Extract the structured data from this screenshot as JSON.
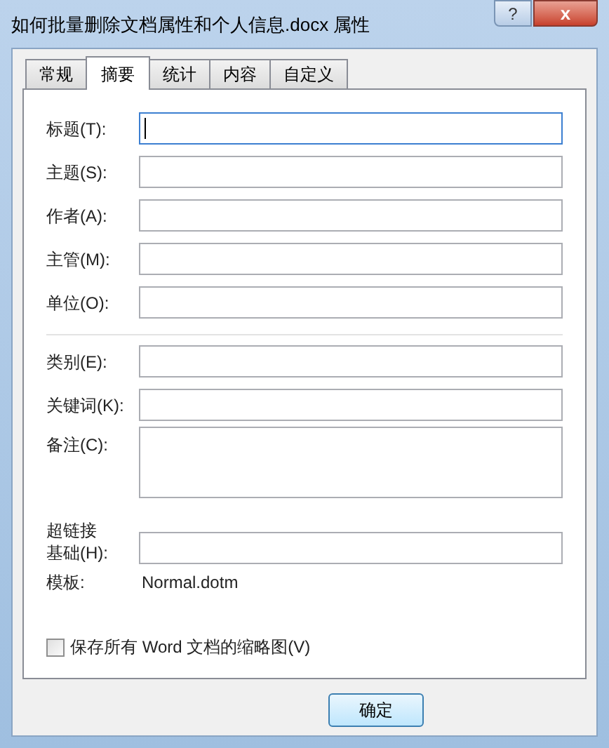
{
  "window": {
    "title": "如何批量删除文档属性和个人信息.docx 属性",
    "help_button": "?",
    "close_button": "x"
  },
  "tabs": [
    {
      "label": "常规",
      "selected": false
    },
    {
      "label": "摘要",
      "selected": true
    },
    {
      "label": "统计",
      "selected": false
    },
    {
      "label": "内容",
      "selected": false
    },
    {
      "label": "自定义",
      "selected": false
    }
  ],
  "field_groups": [
    [
      {
        "label": "标题(T):",
        "kind": "text",
        "focused": true
      },
      {
        "label": "主题(S):",
        "kind": "text",
        "focused": false
      },
      {
        "label": "作者(A):",
        "kind": "text",
        "focused": false
      },
      {
        "label": "主管(M):",
        "kind": "text",
        "focused": false
      },
      {
        "label": "单位(O):",
        "kind": "text",
        "focused": false
      }
    ],
    [
      {
        "label": "类别(E):",
        "kind": "text",
        "focused": false
      },
      {
        "label": "关键词(K):",
        "kind": "text",
        "focused": false
      },
      {
        "label": "备注(C):",
        "kind": "multiline",
        "focused": false
      },
      {
        "label": "超链接基础(H):",
        "kind": "wrapped",
        "focused": false
      }
    ]
  ],
  "template": {
    "label": "模板:",
    "value": "Normal.dotm"
  },
  "thumbnail_checkbox": {
    "label": "保存所有 Word 文档的缩略图(V)",
    "checked": false
  },
  "buttons": [
    "确定"
  ]
}
